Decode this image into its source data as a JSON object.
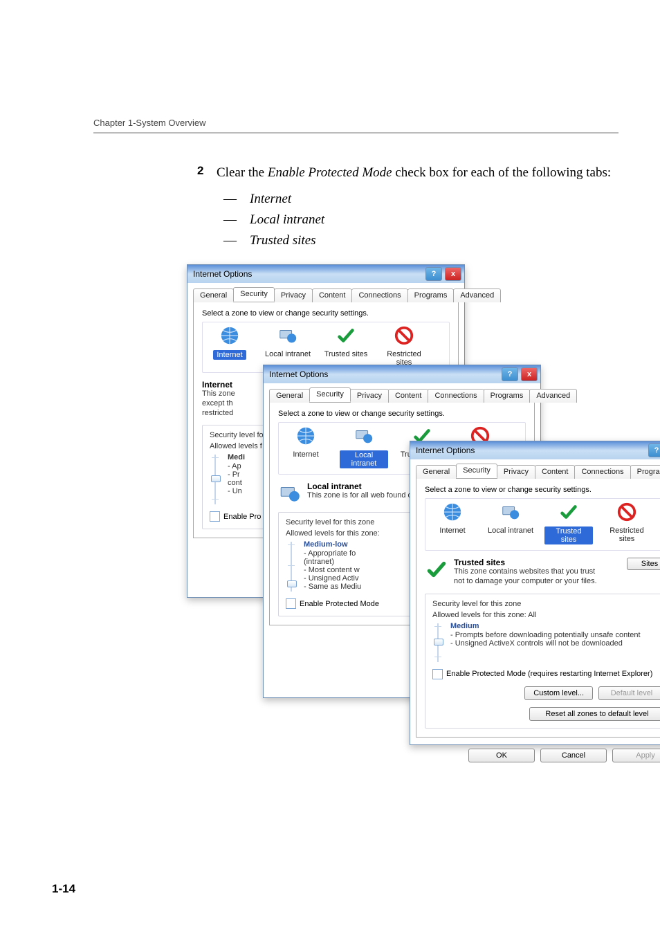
{
  "header": {
    "chapter": "Chapter 1-System Overview"
  },
  "step": {
    "number": "2",
    "text_before": "Clear the ",
    "em": "Enable Protected Mode",
    "text_after": " check box for each of the following tabs:",
    "bullets": [
      "Internet",
      "Local intranet",
      "Trusted sites"
    ]
  },
  "dlg": {
    "title": "Internet Options",
    "tabs": [
      "General",
      "Security",
      "Privacy",
      "Content",
      "Connections",
      "Programs",
      "Advanced"
    ],
    "select_zone_label": "Select a zone to view or change security settings.",
    "zones": {
      "internet": "Internet",
      "local_intranet": "Local intranet",
      "trusted": "Trusted sites",
      "restricted": "Restricted sites"
    },
    "sites_btn": "Sites",
    "sec_level_title": "Security level for this zone",
    "panel1": {
      "zone_name": "Internet",
      "zone_text1": "This zone",
      "zone_text2": "except th",
      "zone_text3": "restricted",
      "allowed": "Allowed levels f",
      "level_name": "Medi",
      "l1": "- Ap",
      "l2": "- Pr",
      "l3": "cont",
      "l4": "- Un",
      "enable_protected": "Enable Pro"
    },
    "panel2": {
      "zone_name": "Local intranet",
      "zone_text": "This zone is for all web found on your intrane",
      "allowed": "Allowed levels for this zone:",
      "level_name": "Medium-low",
      "l1": "- Appropriate fo",
      "l2": "(intranet)",
      "l3": "- Most content w",
      "l4": "- Unsigned Activ",
      "l5": "- Same as Mediu",
      "enable_protected": "Enable Protected Mode"
    },
    "panel3": {
      "zone_name": "Trusted sites",
      "zone_text": "This zone contains websites that you trust not to damage your computer or your files.",
      "allowed": "Allowed levels for this zone: All",
      "level_name": "Medium",
      "l1": "- Prompts before downloading potentially unsafe content",
      "l2": "- Unsigned ActiveX controls will not be downloaded",
      "enable_protected": "Enable Protected Mode (requires restarting Internet Explorer)",
      "custom_btn": "Custom level...",
      "default_btn": "Default level",
      "reset_btn": "Reset all zones to default level",
      "ok": "OK",
      "cancel": "Cancel",
      "apply": "Apply"
    }
  },
  "page_num": "1-14"
}
